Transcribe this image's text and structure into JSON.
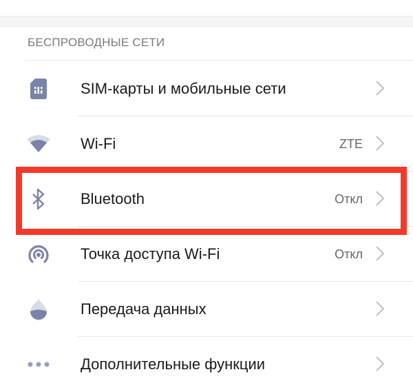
{
  "section_title": "БЕСПРОВОДНЫЕ СЕТИ",
  "accent_color": "#7c83a8",
  "highlight_color": "#f23a2b",
  "items": [
    {
      "label": "SIM-карты и мобильные сети",
      "value": "",
      "icon": "sim-card-icon"
    },
    {
      "label": "Wi-Fi",
      "value": "ZTE",
      "icon": "wifi-icon"
    },
    {
      "label": "Bluetooth",
      "value": "Откл",
      "icon": "bluetooth-icon"
    },
    {
      "label": "Точка доступа Wi-Fi",
      "value": "Откл",
      "icon": "hotspot-icon"
    },
    {
      "label": "Передача данных",
      "value": "",
      "icon": "data-usage-icon"
    },
    {
      "label": "Дополнительные функции",
      "value": "",
      "icon": "more-icon"
    }
  ]
}
